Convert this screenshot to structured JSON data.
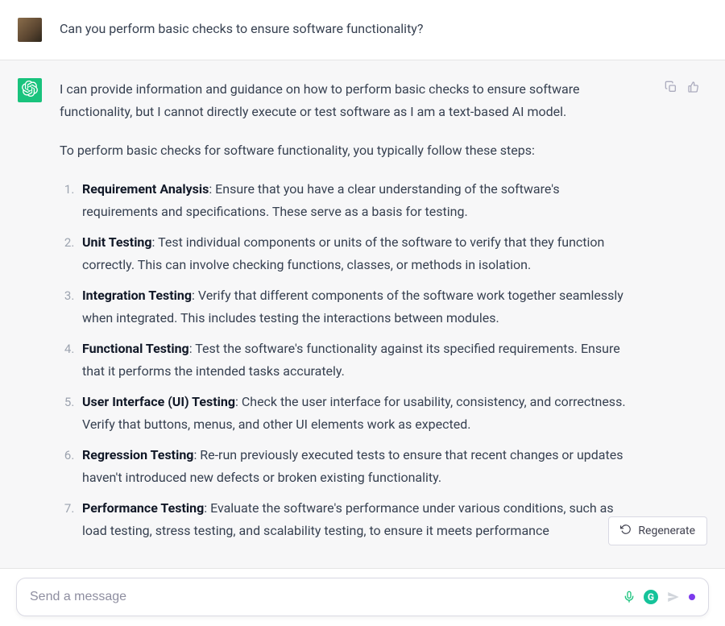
{
  "user": {
    "message": "Can you perform basic checks to ensure software functionality?"
  },
  "assistant": {
    "intro1": "I can provide information and guidance on how to perform basic checks to ensure software functionality, but I cannot directly execute or test software as I am a text-based AI model.",
    "intro2": "To perform basic checks for software functionality, you typically follow these steps:",
    "steps": [
      {
        "title": "Requirement Analysis",
        "desc": ": Ensure that you have a clear understanding of the software's requirements and specifications. These serve as a basis for testing."
      },
      {
        "title": "Unit Testing",
        "desc": ": Test individual components or units of the software to verify that they function correctly. This can involve checking functions, classes, or methods in isolation."
      },
      {
        "title": "Integration Testing",
        "desc": ": Verify that different components of the software work together seamlessly when integrated. This includes testing the interactions between modules."
      },
      {
        "title": "Functional Testing",
        "desc": ": Test the software's functionality against its specified requirements. Ensure that it performs the intended tasks accurately."
      },
      {
        "title": "User Interface (UI) Testing",
        "desc": ": Check the user interface for usability, consistency, and correctness. Verify that buttons, menus, and other UI elements work as expected."
      },
      {
        "title": "Regression Testing",
        "desc": ": Re-run previously executed tests to ensure that recent changes or updates haven't introduced new defects or broken existing functionality."
      },
      {
        "title": "Performance Testing",
        "desc": ": Evaluate the software's performance under various conditions, such as load testing, stress testing, and scalability testing, to ensure it meets performance"
      }
    ]
  },
  "regenerate_label": "Regenerate",
  "composer": {
    "placeholder": "Send a message",
    "value": ""
  }
}
